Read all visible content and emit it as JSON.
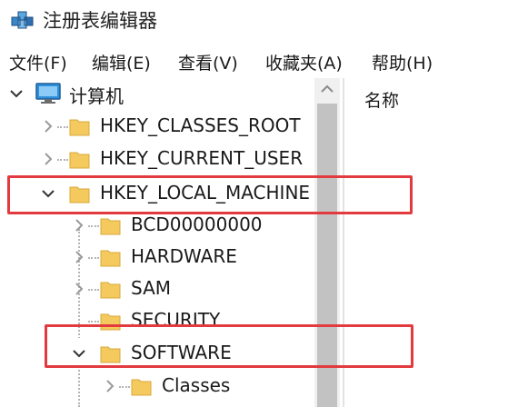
{
  "window": {
    "title": "注册表编辑器"
  },
  "menu": {
    "file": "文件(F)",
    "edit": "编辑(E)",
    "view": "查看(V)",
    "favorites": "收藏夹(A)",
    "help": "帮助(H)"
  },
  "tree": {
    "root": "计算机",
    "hkcr": "HKEY_CLASSES_ROOT",
    "hkcu": "HKEY_CURRENT_USER",
    "hklm": "HKEY_LOCAL_MACHINE",
    "bcd": "BCD00000000",
    "hardware": "HARDWARE",
    "sam": "SAM",
    "security": "SECURITY",
    "software": "SOFTWARE",
    "classes": "Classes"
  },
  "list": {
    "column_name": "名称"
  },
  "colors": {
    "highlight": "#e23a3f",
    "folder": "#f4c95d",
    "scrollbar_thumb": "#c2c2c2"
  },
  "icons": [
    "regedit-icon",
    "computer-icon",
    "folder-icon",
    "chevron-right-icon",
    "chevron-down-icon",
    "scroll-up-icon"
  ]
}
